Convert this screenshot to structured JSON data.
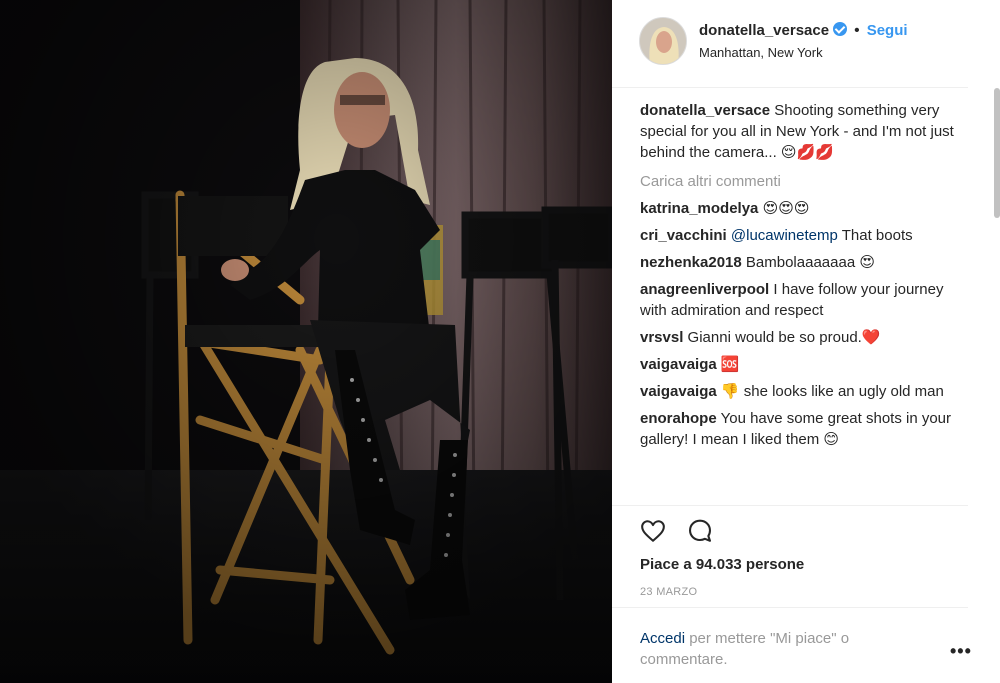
{
  "header": {
    "username": "donatella_versace",
    "separator": "•",
    "follow_label": "Segui",
    "location": "Manhattan, New York"
  },
  "caption": {
    "username": "donatella_versace",
    "text": "Shooting something very special for you all in New York - and I'm not just behind the camera... 😌💋💋"
  },
  "load_more_label": "Carica altri commenti",
  "comments": [
    {
      "username": "katrina_modelya",
      "text": "😍😍😍"
    },
    {
      "username": "cri_vacchini",
      "mention": "@lucawinetemp",
      "text": "That boots"
    },
    {
      "username": "nezhenka2018",
      "text": "Bambolaaaaaaa 😍"
    },
    {
      "username": "anagreenliverpool",
      "text": "I have follow your journey with admiration and respect"
    },
    {
      "username": "vrsvsl",
      "text": "Gianni would be so proud.❤️"
    },
    {
      "username": "vaigavaiga",
      "text": "🆘"
    },
    {
      "username": "vaigavaiga",
      "text": "👎 she looks like an ugly old man"
    },
    {
      "username": "enorahope",
      "text": "You have some great shots in your gallery! I mean I liked them 😊"
    }
  ],
  "actions": {
    "like_icon": "heart-icon",
    "comment_icon": "comment-bubble-icon"
  },
  "likes_text": "Piace a 94.033 persone",
  "date": "23 MARZO",
  "footer": {
    "login_link": "Accedi",
    "login_rest": "per mettere \"Mi piace\" o commentare.",
    "more_label": "•••"
  },
  "colors": {
    "link_blue": "#3897f0",
    "dark_link": "#003569",
    "muted": "#999999",
    "text": "#262626"
  }
}
